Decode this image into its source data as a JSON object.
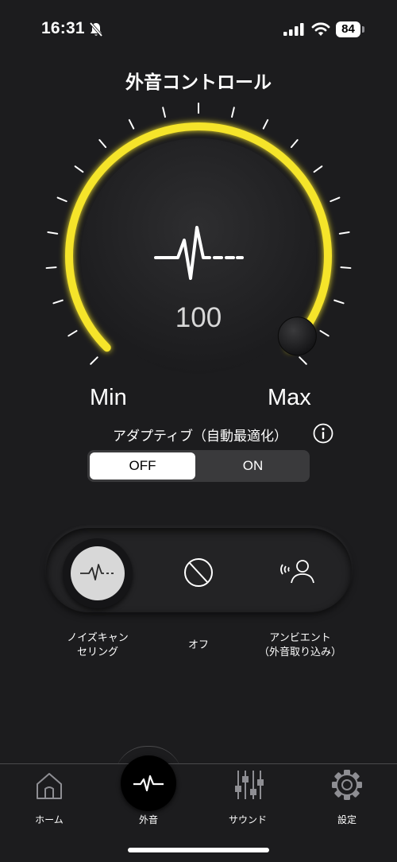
{
  "status_bar": {
    "time": "16:31",
    "battery": "84",
    "icons": [
      "bell-slash-icon",
      "cellular-signal-icon",
      "wifi-icon",
      "battery-icon"
    ]
  },
  "page": {
    "title": "外音コントロール"
  },
  "dial": {
    "value": "100",
    "level_fraction": 1.0,
    "min_label": "Min",
    "max_label": "Max",
    "icon": "waveform-icon",
    "accent_color": "#f5e42a"
  },
  "adaptive": {
    "label": "アダプティブ（自動最適化）",
    "info_icon": "info-icon",
    "options": {
      "off": "OFF",
      "on": "ON"
    },
    "selected": "OFF"
  },
  "modes": {
    "items": [
      {
        "label_line1": "ノイズキャン",
        "label_line2": "セリング",
        "icon": "noise-cancelling-icon",
        "selected": true
      },
      {
        "label_line1": "オフ",
        "label_line2": "",
        "icon": "off-icon",
        "selected": false
      },
      {
        "label_line1": "アンビエント",
        "label_line2": "（外音取り込み）",
        "icon": "ambient-icon",
        "selected": false
      }
    ]
  },
  "tabbar": {
    "items": [
      {
        "label": "ホーム",
        "icon": "home-icon"
      },
      {
        "label": "外音",
        "icon": "waveform-icon",
        "active": true
      },
      {
        "label": "サウンド",
        "icon": "equalizer-icon"
      },
      {
        "label": "設定",
        "icon": "gear-icon"
      }
    ]
  }
}
